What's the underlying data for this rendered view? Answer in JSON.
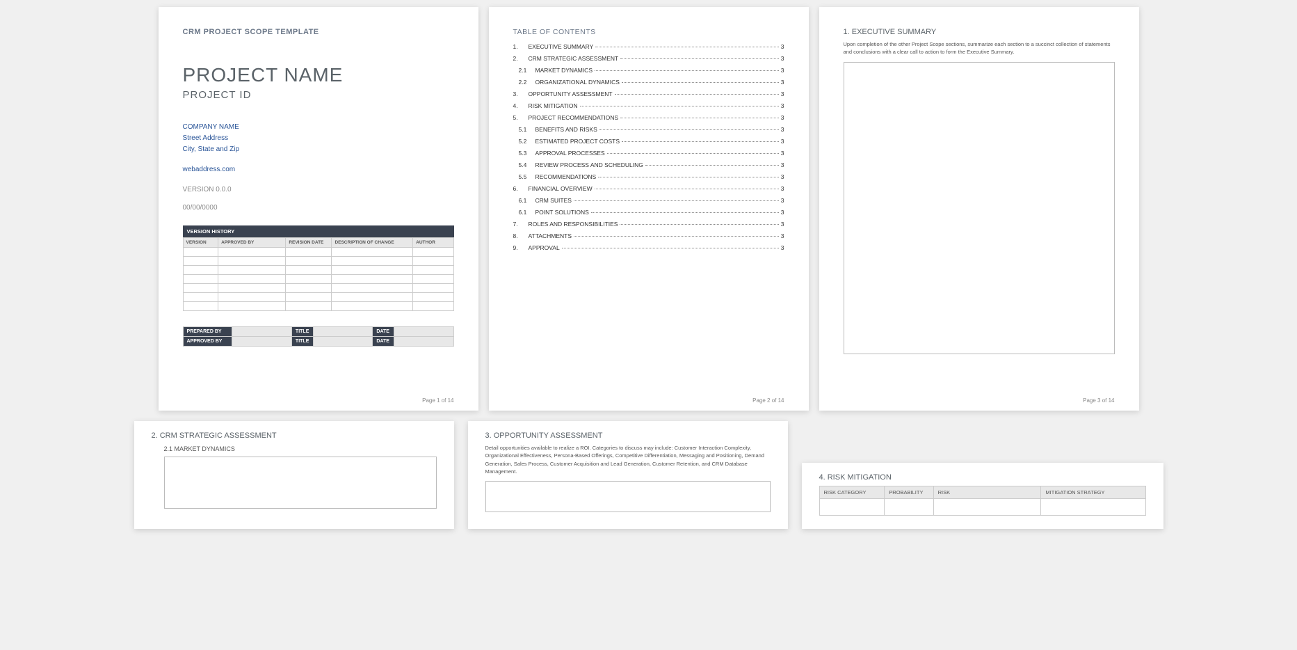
{
  "page1": {
    "templateTitle": "CRM PROJECT SCOPE TEMPLATE",
    "projectName": "PROJECT NAME",
    "projectId": "PROJECT ID",
    "companyName": "COMPANY NAME",
    "street": "Street Address",
    "cityStateZip": "City, State and Zip",
    "web": "webaddress.com",
    "version": "VERSION 0.0.0",
    "date": "00/00/0000",
    "versionHistoryHeader": "VERSION HISTORY",
    "vhCols": {
      "c1": "VERSION",
      "c2": "APPROVED BY",
      "c3": "REVISION DATE",
      "c4": "DESCRIPTION OF CHANGE",
      "c5": "AUTHOR"
    },
    "sig": {
      "preparedBy": "PREPARED BY",
      "approvedBy": "APPROVED BY",
      "title": "TITLE",
      "date": "DATE"
    },
    "footer": "Page 1 of 14"
  },
  "page2": {
    "tocTitle": "TABLE OF CONTENTS",
    "items": [
      {
        "num": "1.",
        "label": "EXECUTIVE SUMMARY",
        "pg": "3",
        "sub": false
      },
      {
        "num": "2.",
        "label": "CRM STRATEGIC ASSESSMENT",
        "pg": "3",
        "sub": false
      },
      {
        "num": "2.1",
        "label": "MARKET DYNAMICS",
        "pg": "3",
        "sub": true
      },
      {
        "num": "2.2",
        "label": "ORGANIZATIONAL DYNAMICS",
        "pg": "3",
        "sub": true
      },
      {
        "num": "3.",
        "label": "OPPORTUNITY ASSESSMENT",
        "pg": "3",
        "sub": false
      },
      {
        "num": "4.",
        "label": "RISK MITIGATION",
        "pg": "3",
        "sub": false
      },
      {
        "num": "5.",
        "label": "PROJECT RECOMMENDATIONS",
        "pg": "3",
        "sub": false
      },
      {
        "num": "5.1",
        "label": "BENEFITS AND RISKS",
        "pg": "3",
        "sub": true
      },
      {
        "num": "5.2",
        "label": "ESTIMATED PROJECT COSTS",
        "pg": "3",
        "sub": true
      },
      {
        "num": "5.3",
        "label": "APPROVAL PROCESSES",
        "pg": "3",
        "sub": true
      },
      {
        "num": "5.4",
        "label": "REVIEW PROCESS AND SCHEDULING",
        "pg": "3",
        "sub": true
      },
      {
        "num": "5.5",
        "label": "RECOMMENDATIONS",
        "pg": "3",
        "sub": true
      },
      {
        "num": "6.",
        "label": "FINANCIAL OVERVIEW",
        "pg": "3",
        "sub": false
      },
      {
        "num": "6.1",
        "label": "CRM SUITES",
        "pg": "3",
        "sub": true
      },
      {
        "num": "6.1",
        "label": "POINT SOLUTIONS",
        "pg": "3",
        "sub": true
      },
      {
        "num": "7.",
        "label": "ROLES AND RESPONSIBILITIES",
        "pg": "3",
        "sub": false
      },
      {
        "num": "8.",
        "label": "ATTACHMENTS",
        "pg": "3",
        "sub": false
      },
      {
        "num": "9.",
        "label": "APPROVAL",
        "pg": "3",
        "sub": false
      }
    ],
    "footer": "Page 2 of 14"
  },
  "page3": {
    "title": "1.  EXECUTIVE SUMMARY",
    "desc": "Upon completion of the other Project Scope sections, summarize each section to a succinct collection of statements and conclusions with a clear call to action to form the Executive Summary.",
    "footer": "Page 3 of 14"
  },
  "page4": {
    "title": "2.  CRM STRATEGIC ASSESSMENT",
    "sub": "2.1      MARKET DYNAMICS"
  },
  "page5": {
    "title": "3.  OPPORTUNITY ASSESSMENT",
    "desc": "Detail opportunities available to realize a ROI.  Categories to discuss may include: Customer Interaction Complexity, Organizational Effectiveness, Persona-Based Offerings, Competitive Differentiation, Messaging and Positioning, Demand Generation, Sales Process, Customer Acquisition and Lead Generation, Customer Retention, and CRM Database Management."
  },
  "page6": {
    "title": "4.  RISK MITIGATION",
    "cols": {
      "c1": "RISK CATEGORY",
      "c2": "PROBABILITY",
      "c3": "RISK",
      "c4": "MITIGATION STRATEGY"
    }
  }
}
